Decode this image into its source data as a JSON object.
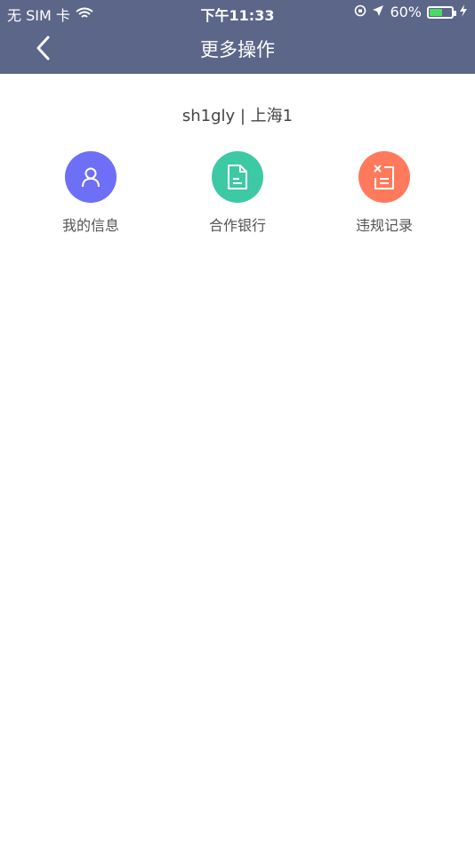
{
  "status_bar": {
    "carrier": "无 SIM 卡",
    "time": "下午11:33",
    "battery": "60%",
    "battery_level": 0.6,
    "icons": [
      "wifi-icon",
      "rotation-lock-icon",
      "location-arrow-icon",
      "battery-icon",
      "charging-bolt-icon"
    ]
  },
  "nav": {
    "back_icon": "chevron-left-icon",
    "title": "更多操作"
  },
  "account": {
    "text": "sh1gly | 上海1"
  },
  "actions": [
    {
      "label": "我的信息",
      "icon": "user-icon",
      "color": "#6e6ff7"
    },
    {
      "label": "合作银行",
      "icon": "document-icon",
      "color": "#3dc9a4"
    },
    {
      "label": "违规记录",
      "icon": "violation-record-icon",
      "color": "#ff7a5d"
    }
  ],
  "colors": {
    "header_bg": "#5b6688",
    "page_bg": "#ffffff"
  }
}
